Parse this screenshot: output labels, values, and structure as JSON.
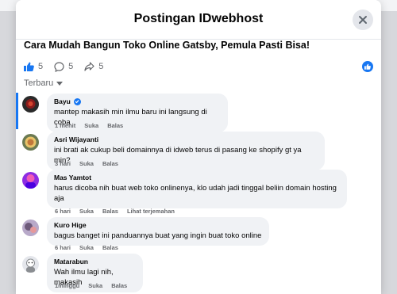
{
  "dialog": {
    "title": "Postingan IDwebhost",
    "close_icon": "close-icon"
  },
  "post": {
    "title": "Cara Mudah Bangun Toko Online Gatsby, Pemula Pasti Bisa!"
  },
  "reactions": {
    "likes": "5",
    "comments": "5",
    "shares": "5"
  },
  "sort": {
    "label": "Terbaru"
  },
  "comments": [
    {
      "name": "Bayu",
      "verified": true,
      "text": "mantep makasih min ilmu baru ini langsung di coba",
      "time": "1 menit",
      "like": "Suka",
      "reply": "Balas"
    },
    {
      "name": "Asri Wijayanti",
      "text": "ini brati ak cukup beli domainnya di idweb terus di pasang ke shopify gt ya min?",
      "time": "3 hari",
      "like": "Suka",
      "reply": "Balas"
    },
    {
      "name": "Mas Yamtot",
      "text_line1": "harus dicoba nih buat web toko onlinenya, klo udah jadi tinggal beliin domain hosting",
      "text_line2": "aja",
      "time": "6 hari",
      "like": "Suka",
      "reply": "Balas",
      "translate": "Lihat terjemahan"
    },
    {
      "name": "Kuro Hige",
      "text": "bagus banget ini panduannya buat yang ingin buat toko online",
      "time": "6 hari",
      "like": "Suka",
      "reply": "Balas"
    },
    {
      "name": "Matarabun",
      "text": "Wah ilmu lagi nih, makasih",
      "time": "1minggu",
      "like": "Suka",
      "reply": "Balas"
    }
  ],
  "colors": {
    "accent": "#1877f2",
    "bubble": "#f0f2f5",
    "muted": "#65676b"
  }
}
